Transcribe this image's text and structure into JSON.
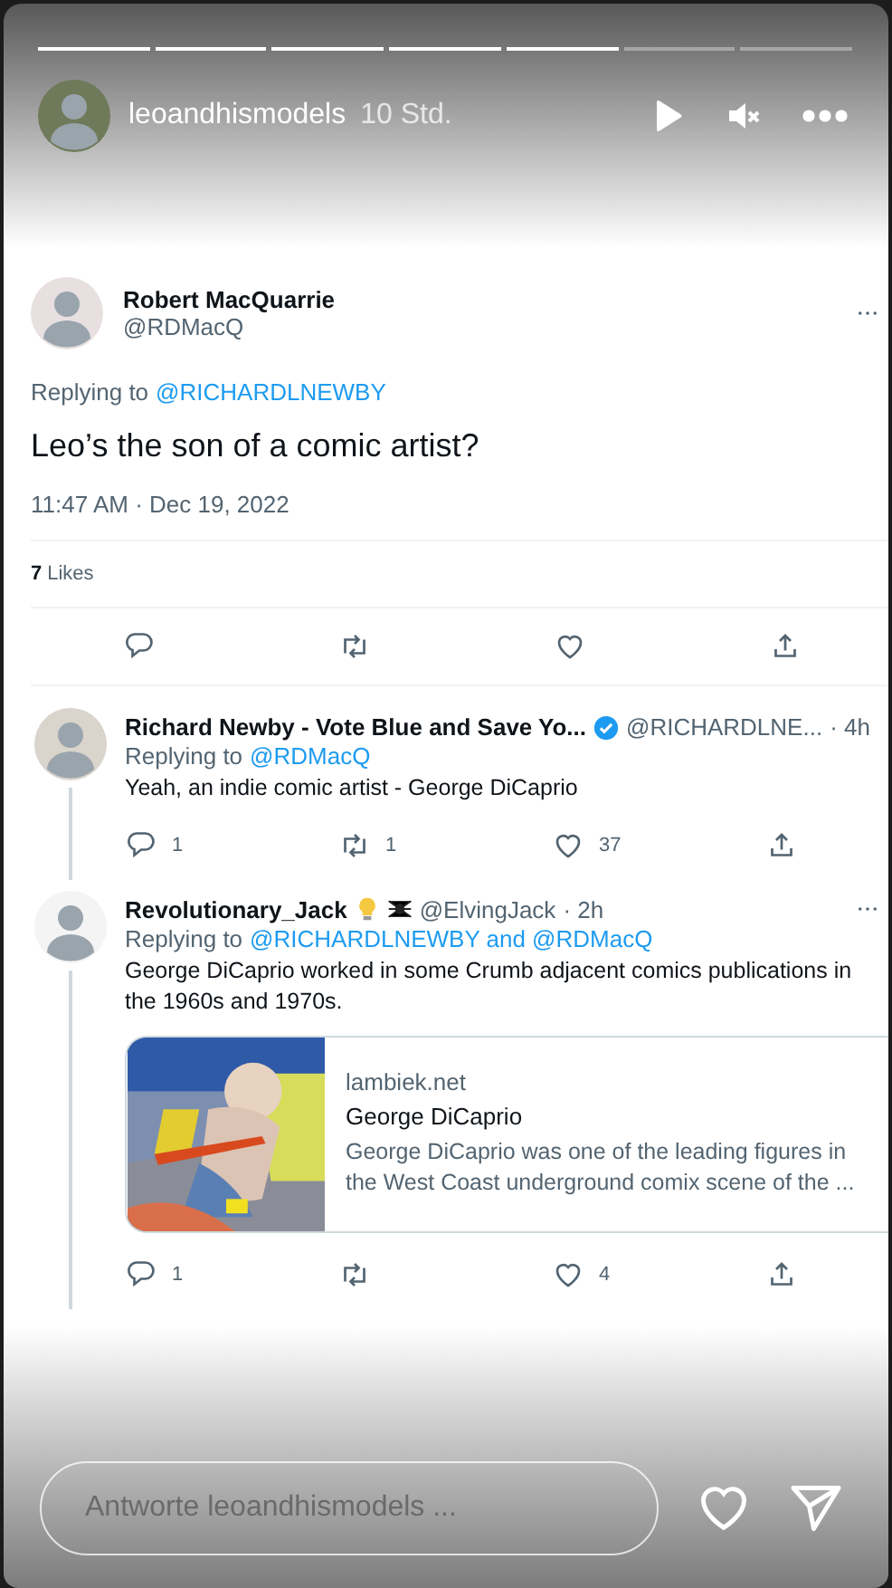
{
  "story": {
    "progress": [
      {
        "level": 1
      },
      {
        "level": 1
      },
      {
        "level": 1
      },
      {
        "level": 1
      },
      {
        "level": 1
      },
      {
        "level": 0
      },
      {
        "level": 0
      }
    ],
    "user": "leoandhismodels",
    "time": "10 Std.",
    "muted": true
  },
  "main_tweet": {
    "name": "Robert MacQuarrie",
    "handle": "@RDMacQ",
    "replying_label": "Replying to",
    "replying_to": "@RICHARDLNEWBY",
    "text": "Leo’s the son of a comic artist?",
    "timestamp": "11:47 AM · Dec 19, 2022",
    "likes_count": "7",
    "likes_label": "Likes",
    "actions": [
      {
        "kind": "reply"
      },
      {
        "kind": "retweet"
      },
      {
        "kind": "like"
      },
      {
        "kind": "share"
      }
    ]
  },
  "replies": [
    {
      "name": "Richard Newby - Vote Blue and Save Yo...",
      "verified": true,
      "handle": "@RICHARDLNE...",
      "time": "· 4h",
      "replying_label": "Replying to",
      "replying_to": "@RDMacQ",
      "text": "Yeah, an indie comic artist - George DiCaprio",
      "actions": [
        {
          "kind": "reply",
          "count": "1"
        },
        {
          "kind": "retweet",
          "count": "1"
        },
        {
          "kind": "like",
          "count": "37"
        },
        {
          "kind": "share"
        }
      ]
    },
    {
      "name": "Revolutionary_Jack",
      "verified": false,
      "badges": [
        {
          "kind": "bulb"
        },
        {
          "kind": "spider"
        }
      ],
      "handle": "@ElvingJack",
      "time": "· 2h",
      "replying_label": "Replying to",
      "replying_to": "@RICHARDLNEWBY and @RDMacQ",
      "text": "George DiCaprio worked in some Crumb adjacent comics publications in the 1960s and 1970s.",
      "link_card": {
        "kind": "picture",
        "domain": "lambiek.net",
        "title": "George DiCaprio",
        "description": "George DiCaprio was one of the leading figures in the West Coast underground comix scene of the ..."
      },
      "actions": [
        {
          "kind": "reply",
          "count": "1"
        },
        {
          "kind": "retweet"
        },
        {
          "kind": "like",
          "count": "4"
        },
        {
          "kind": "share"
        }
      ]
    }
  ],
  "reply_field": {
    "placeholder": "Antworte leoandhismodels ..."
  }
}
